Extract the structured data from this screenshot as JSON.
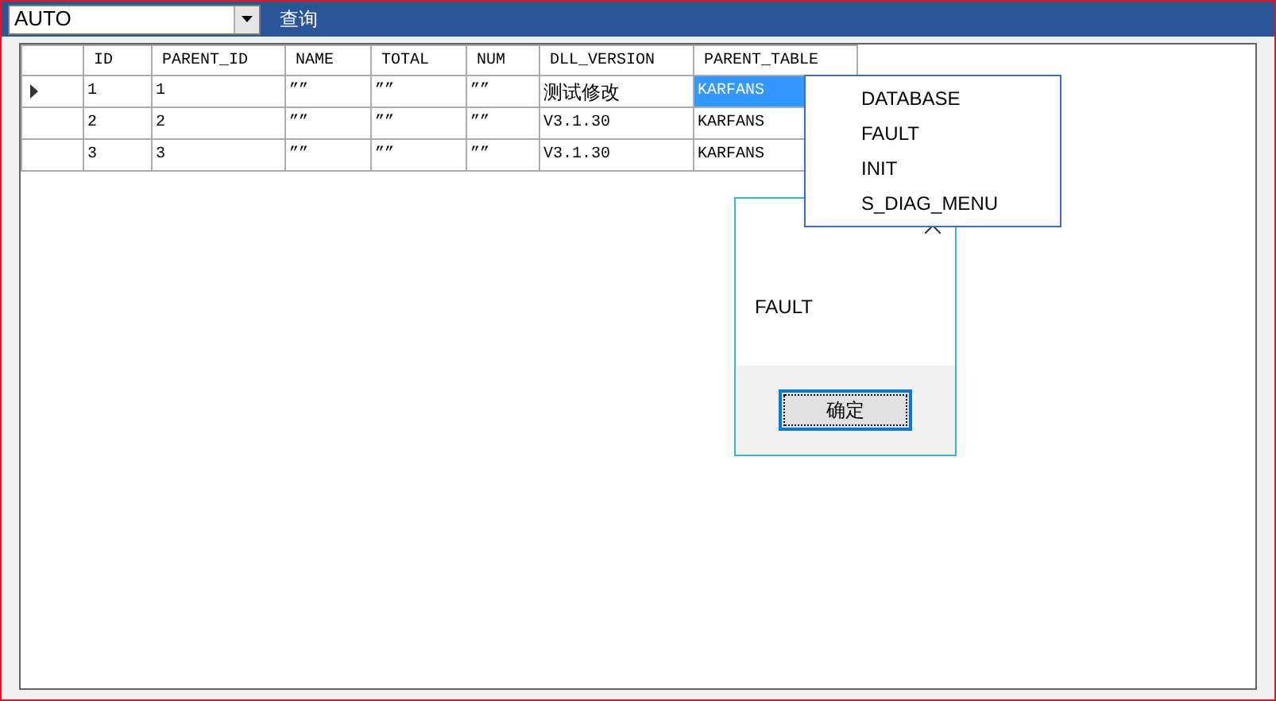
{
  "toolbar": {
    "combo_value": "AUTO",
    "query_button": "查询"
  },
  "table": {
    "columns": [
      "ID",
      "PARENT_ID",
      "NAME",
      "TOTAL",
      "NUM",
      "DLL_VERSION",
      "PARENT_TABLE"
    ],
    "rows": [
      {
        "current": true,
        "cells": [
          {
            "text": "1",
            "selected": false
          },
          {
            "text": "1",
            "selected": false
          },
          {
            "text": "””",
            "selected": false
          },
          {
            "text": "””",
            "selected": false
          },
          {
            "text": "””",
            "selected": false
          },
          {
            "text": "测试修改",
            "selected": false
          },
          {
            "text": "KARFANS",
            "selected": true
          }
        ]
      },
      {
        "current": false,
        "cells": [
          {
            "text": "2",
            "selected": false
          },
          {
            "text": "2",
            "selected": false
          },
          {
            "text": "””",
            "selected": false
          },
          {
            "text": "””",
            "selected": false
          },
          {
            "text": "””",
            "selected": false
          },
          {
            "text": "V3.1.30",
            "selected": false
          },
          {
            "text": "KARFANS",
            "selected": false
          }
        ]
      },
      {
        "current": false,
        "cells": [
          {
            "text": "3",
            "selected": false
          },
          {
            "text": "3",
            "selected": false
          },
          {
            "text": "””",
            "selected": false
          },
          {
            "text": "””",
            "selected": false
          },
          {
            "text": "””",
            "selected": false
          },
          {
            "text": "V3.1.30",
            "selected": false
          },
          {
            "text": "KARFANS",
            "selected": false
          }
        ]
      }
    ]
  },
  "dropdown": {
    "items": [
      "DATABASE",
      "FAULT",
      "INIT",
      "S_DIAG_MENU"
    ]
  },
  "message_box": {
    "text": "FAULT",
    "ok_button": "确定"
  }
}
